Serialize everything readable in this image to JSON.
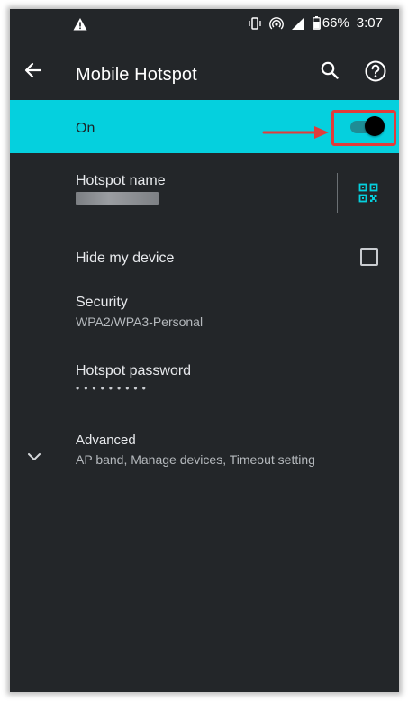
{
  "status_bar": {
    "warning_icon": "alert-triangle-icon",
    "vibrate_icon": "vibrate-icon",
    "hotspot_icon": "hotspot-icon",
    "signal_icon": "signal-icon",
    "battery_icon": "battery-icon",
    "battery": "66%",
    "time": "3:07"
  },
  "app_bar": {
    "title": "Mobile Hotspot",
    "back_icon": "arrow-left-icon",
    "search_icon": "search-icon",
    "help_icon": "help-circle-icon"
  },
  "master_switch": {
    "label": "On",
    "state": "on",
    "accent_color": "#05d0de",
    "annotation_color": "#e23b3b"
  },
  "settings": {
    "hotspot_name": {
      "title": "Hotspot name",
      "action_icon": "qr-code-icon"
    },
    "hide_device": {
      "title": "Hide my device",
      "checked": false
    },
    "security": {
      "title": "Security",
      "value": "WPA2/WPA3-Personal"
    },
    "password": {
      "title": "Hotspot password",
      "masked_value": "•••••••••"
    },
    "advanced": {
      "title": "Advanced",
      "summary": "AP band, Manage devices, Timeout setting",
      "icon": "chevron-down-icon"
    }
  }
}
